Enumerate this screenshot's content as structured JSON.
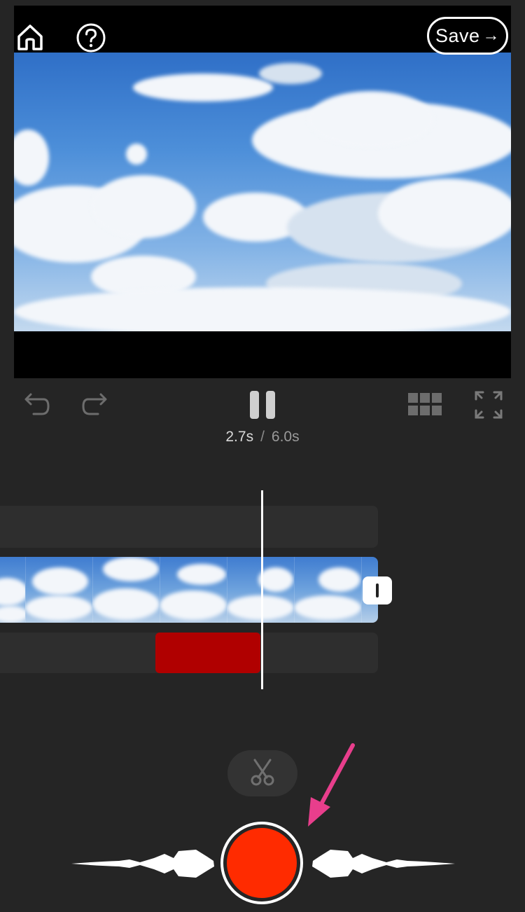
{
  "header": {
    "save_label": "Save",
    "save_arrow": "→"
  },
  "icons": {
    "home": "home-icon",
    "help": "help-icon",
    "undo": "undo-icon",
    "redo": "redo-icon",
    "pause": "pause-icon",
    "grid": "grid-icon",
    "fullscreen": "fullscreen-icon",
    "scissors": "scissors-icon",
    "record": "record-icon"
  },
  "playback": {
    "current_time": "2.7s",
    "separator": "/",
    "total_time": "6.0s"
  },
  "colors": {
    "background": "#252525",
    "record": "#ff2b00",
    "recorded_segment": "#b00000",
    "annotation_arrow": "#e83e8c"
  }
}
